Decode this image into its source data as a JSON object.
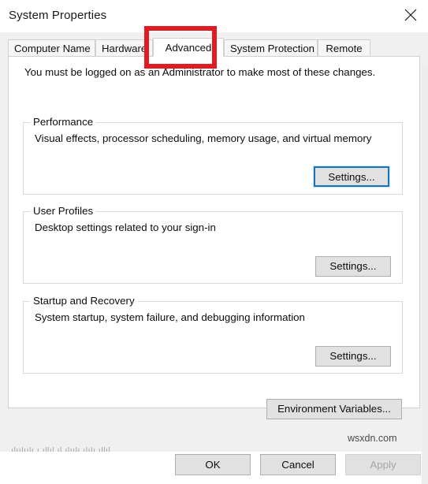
{
  "window": {
    "title": "System Properties",
    "close_icon": "close-icon"
  },
  "tabs": [
    {
      "label": "Computer Name",
      "active": false
    },
    {
      "label": "Hardware",
      "active": false
    },
    {
      "label": "Advanced",
      "active": true
    },
    {
      "label": "System Protection",
      "active": false
    },
    {
      "label": "Remote",
      "active": false
    }
  ],
  "page": {
    "admin_note": "You must be logged on as an Administrator to make most of these changes.",
    "groups": [
      {
        "label": "Performance",
        "description": "Visual effects, processor scheduling, memory usage, and virtual memory",
        "button_label": "Settings...",
        "button_focused": true
      },
      {
        "label": "User Profiles",
        "description": "Desktop settings related to your sign-in",
        "button_label": "Settings...",
        "button_focused": false
      },
      {
        "label": "Startup and Recovery",
        "description": "System startup, system failure, and debugging information",
        "button_label": "Settings...",
        "button_focused": false
      }
    ],
    "environment_variables_label": "Environment Variables..."
  },
  "footer": {
    "ok_label": "OK",
    "cancel_label": "Cancel",
    "apply_label": "Apply",
    "apply_disabled": true
  },
  "overlay": {
    "watermark": "wsxdn.com",
    "annotation_color": "#e01b24",
    "bottom_artifact": "ılıılıılı ı ıllıl ıl ılıılı ılılı ıllıl"
  },
  "colors": {
    "dialog_background": "#f0f0f0",
    "page_background": "#ffffff",
    "focus_border": "#1974b8",
    "text": "#0d0d0d",
    "disabled_text": "#a5a5a5",
    "annotation": "#e01b24"
  }
}
